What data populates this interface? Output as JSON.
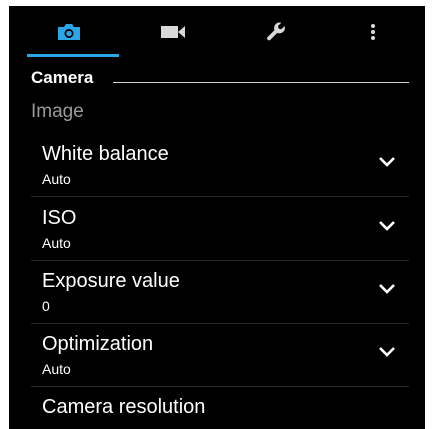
{
  "tabs": [
    {
      "name": "camera-icon",
      "active": true
    },
    {
      "name": "video-camera-icon",
      "active": false
    },
    {
      "name": "wrench-icon",
      "active": false
    },
    {
      "name": "more-vertical-icon",
      "active": false
    }
  ],
  "colors": {
    "accent": "#2aa6e8",
    "background": "#000000",
    "subtext": "#9a9a9a"
  },
  "section": {
    "title": "Camera"
  },
  "group": {
    "label": "Image"
  },
  "settings": [
    {
      "title": "White balance",
      "value": "Auto",
      "icon": "chevron-down-icon"
    },
    {
      "title": "ISO",
      "value": "Auto",
      "icon": "chevron-down-icon"
    },
    {
      "title": "Exposure value",
      "value": "0",
      "icon": "chevron-down-icon"
    },
    {
      "title": "Optimization",
      "value": "Auto",
      "icon": "chevron-down-icon"
    },
    {
      "title": "Camera resolution"
    }
  ]
}
